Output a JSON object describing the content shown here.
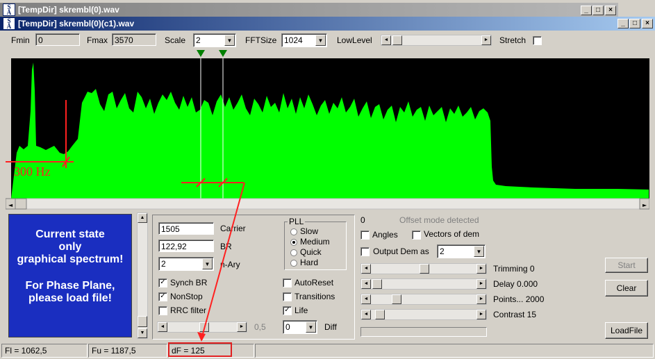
{
  "window_outer": {
    "title": "[TempDir] skrembl(0).wav",
    "icon": "SA"
  },
  "window_inner": {
    "title": "[TempDir] skrembl(0)(c1).wav",
    "icon": "SA"
  },
  "toolbar": {
    "fmin_label": "Fmin",
    "fmin_value": "0",
    "fmax_label": "Fmax",
    "fmax_value": "3570",
    "scale_label": "Scale",
    "scale_value": "2",
    "fftsize_label": "FFTSize",
    "fftsize_value": "1024",
    "lowlevel_label": "LowLevel",
    "stretch_label": "Stretch"
  },
  "spectrum": {
    "annotation": "300 Hz"
  },
  "info_panel": {
    "line1": "Current state",
    "line2": "only",
    "line3": "graphical spectrum!",
    "line4": "For Phase Plane,",
    "line5": "please load file!"
  },
  "params": {
    "carrier_value": "1505",
    "carrier_label": "Carrier",
    "br_value": "122,92",
    "br_label": "BR",
    "nary_value": "2",
    "nary_label": "n-Ary",
    "synch_br": "Synch BR",
    "nonstop": "NonStop",
    "rrc_filter": "RRC filter",
    "slider_value": "0,5"
  },
  "pll": {
    "title": "PLL",
    "options": [
      "Slow",
      "Medium",
      "Quick",
      "Hard"
    ],
    "selected": "Medium"
  },
  "options": {
    "autoreset": "AutoReset",
    "transitions": "Transitions",
    "life": "Life",
    "diff_value": "0",
    "diff_label": "Diff"
  },
  "right": {
    "offset_value": "0",
    "offset_status": "Offset mode detected",
    "angles": "Angles",
    "vectors": "Vectors of dem",
    "output_dem": "Output Dem as",
    "output_dem_value": "2",
    "trimming": "Trimming 0",
    "delay": "Delay  0.000",
    "points": "Points... 2000",
    "contrast": "Contrast 15"
  },
  "buttons": {
    "start": "Start",
    "clear": "Clear",
    "loadfile": "LoadFile"
  },
  "statusbar": {
    "fl": "Fl = 1062,5",
    "fu": "Fu = 1187,5",
    "df": "dF = 125"
  },
  "colors": {
    "spectrum_fill": "#00ff00",
    "annotation": "#ff2020",
    "info_bg": "#1a2ec0"
  }
}
